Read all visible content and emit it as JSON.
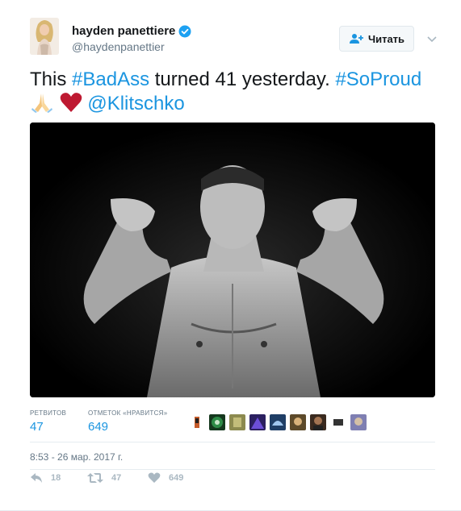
{
  "user": {
    "display_name": "hayden panettiere",
    "handle": "@haydenpanettier",
    "verified_icon": "verified-badge-icon"
  },
  "follow_button": {
    "label": "Читать"
  },
  "tweet": {
    "text_prefix": "This ",
    "hashtag1": "#BadAss",
    "text_middle": " turned 41 yesterday. ",
    "hashtag2": "#SoProud",
    "mention": "@Klitschko",
    "emojis": [
      "folded-hands-icon",
      "red-heart-icon"
    ]
  },
  "stats": {
    "retweets_label": "РЕТВИТОВ",
    "retweets_value": "47",
    "likes_label": "ОТМЕТОК «НРАВИТСЯ»",
    "likes_value": "649"
  },
  "timestamp": "8:53 - 26 мар. 2017 г.",
  "actions": {
    "reply_count": "18",
    "retweet_count": "47",
    "like_count": "649"
  },
  "colors": {
    "link": "#1b95e0",
    "muted": "#657786",
    "action": "#aab8c2",
    "heart": "#e0245e"
  }
}
